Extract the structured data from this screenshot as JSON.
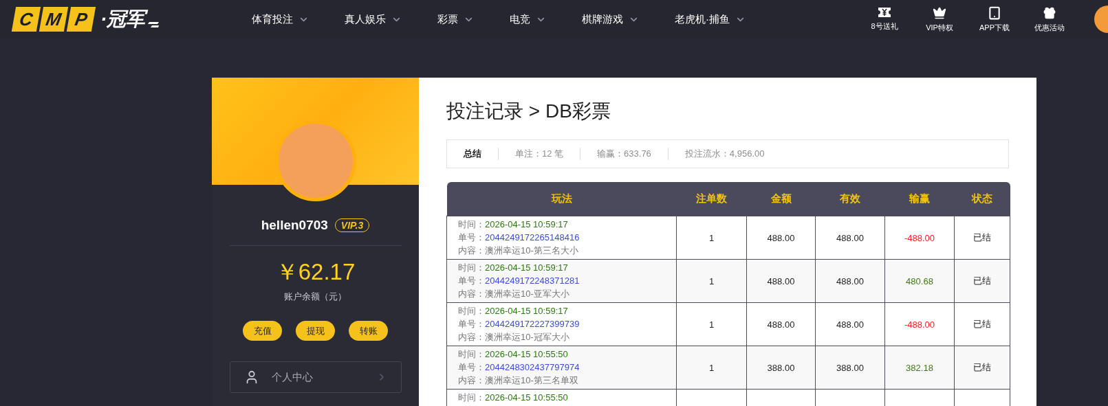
{
  "header": {
    "logo_letters": [
      "C",
      "M",
      "P"
    ],
    "logo_text": "·冠军",
    "nav": [
      {
        "label": "体育投注"
      },
      {
        "label": "真人娱乐"
      },
      {
        "label": "彩票"
      },
      {
        "label": "电竞"
      },
      {
        "label": "棋牌游戏"
      },
      {
        "label": "老虎机·捕鱼"
      }
    ],
    "shortcuts": [
      {
        "kind": "ticket",
        "label": "8号送礼"
      },
      {
        "kind": "crown",
        "label": "VIP特权"
      },
      {
        "kind": "tablet",
        "label": "APP下载"
      },
      {
        "kind": "gift",
        "label": "优惠活动"
      }
    ]
  },
  "sidebar": {
    "username": "hellen0703",
    "vip": "VIP.3",
    "balance": "￥62.17",
    "balance_label": "账户余额（元）",
    "actions": [
      "充值",
      "提现",
      "转账"
    ],
    "menu": [
      {
        "kind": "user",
        "label": "个人中心"
      }
    ]
  },
  "page_title": "投注记录 > DB彩票",
  "summary": {
    "title": "总结",
    "items": [
      "单注：12 笔",
      "输赢：633.76",
      "投注流水：4,956.00"
    ]
  },
  "table": {
    "columns": [
      "玩法",
      "注单数",
      "金额",
      "有效",
      "输赢",
      "状态"
    ],
    "rows": [
      {
        "time_label": "时间：",
        "time": "2026-04-15 10:59:17",
        "order_label": "单号：",
        "order": "2044249172265148416",
        "content_label": "内容：",
        "content": "澳洲幸运10-第三名大小",
        "count": "1",
        "amount": "488.00",
        "valid": "488.00",
        "result": "-488.00",
        "color": "#ff1a1a",
        "status": "已结"
      },
      {
        "time_label": "时间：",
        "time": "2026-04-15 10:59:17",
        "order_label": "单号：",
        "order": "2044249172248371281",
        "content_label": "内容：",
        "content": "澳洲幸运10-亚军大小",
        "count": "1",
        "amount": "488.00",
        "valid": "488.00",
        "result": "480.68",
        "color": "#3d7a10",
        "status": "已结"
      },
      {
        "time_label": "时间：",
        "time": "2026-04-15 10:59:17",
        "order_label": "单号：",
        "order": "2044249172227399739",
        "content_label": "内容：",
        "content": "澳洲幸运10-冠军大小",
        "count": "1",
        "amount": "488.00",
        "valid": "488.00",
        "result": "-488.00",
        "color": "#ff1a1a",
        "status": "已结"
      },
      {
        "time_label": "时间：",
        "time": "2026-04-15 10:55:50",
        "order_label": "单号：",
        "order": "2044248302437797974",
        "content_label": "内容：",
        "content": "澳洲幸运10-第三名单双",
        "count": "1",
        "amount": "388.00",
        "valid": "388.00",
        "result": "382.18",
        "color": "#3d7a10",
        "status": "已结"
      },
      {
        "time_label": "时间：",
        "time": "2026-04-15 10:55:50"
      }
    ]
  }
}
